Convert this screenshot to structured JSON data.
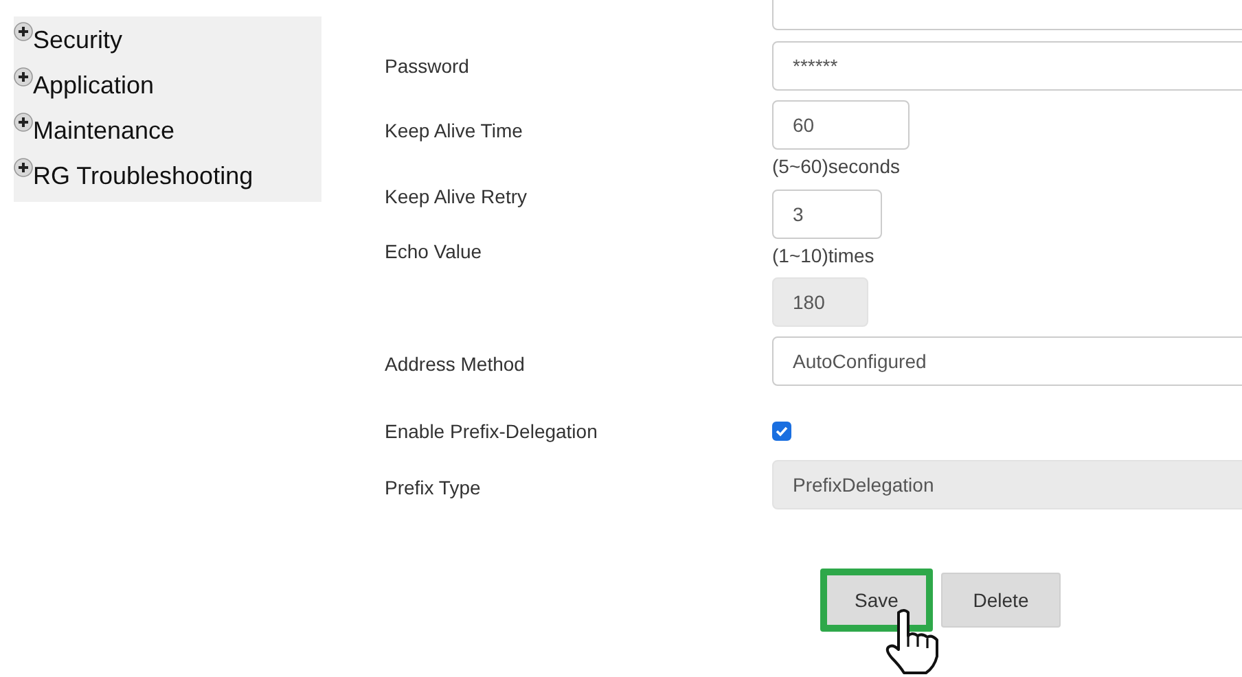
{
  "sidebar": {
    "items": [
      {
        "label": "Security",
        "expanded": false
      },
      {
        "label": "Application",
        "expanded": false
      },
      {
        "label": "Maintenance",
        "expanded": false
      },
      {
        "label": "RG Troubleshooting",
        "expanded": false
      }
    ]
  },
  "form": {
    "rows": [
      {
        "kind": "field",
        "label": "Password",
        "value": "******",
        "disabled": false
      },
      {
        "kind": "field",
        "label": "Keep Alive Time",
        "value": "60",
        "hint": "(5~60)seconds",
        "disabled": false
      },
      {
        "kind": "field",
        "label": "Keep Alive Retry",
        "value": "3",
        "hint": "(1~10)times",
        "disabled": false
      },
      {
        "kind": "field",
        "label": "Echo Value",
        "value": "180",
        "disabled": true
      },
      {
        "kind": "field",
        "label": "Address Method",
        "value": "AutoConfigured",
        "disabled": false
      },
      {
        "kind": "checkbox",
        "label": "Enable Prefix-Delegation",
        "checked": true
      },
      {
        "kind": "field",
        "label": "Prefix Type",
        "value": "PrefixDelegation",
        "disabled": true
      }
    ]
  },
  "buttons": [
    {
      "label": "Save",
      "highlighted": true
    },
    {
      "label": "Delete",
      "highlighted": false
    }
  ]
}
